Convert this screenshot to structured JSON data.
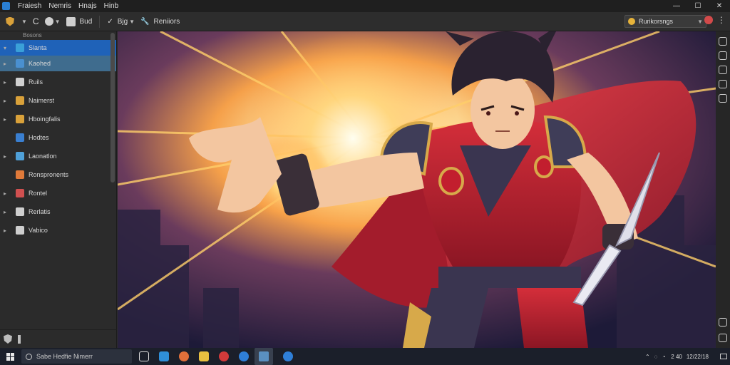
{
  "menu": [
    "Fraiesh",
    "Nemris",
    "Hnajs",
    "Hinb"
  ],
  "toolbar": {
    "edit_label": "Bjg",
    "tool_label": "Reniiors",
    "app_label": "Bud",
    "profile": "Rurikorsngs"
  },
  "sidebar": {
    "header": "Bosons",
    "items": [
      {
        "label": "Slanta",
        "color": "#3aa0d8",
        "state": "selected",
        "arrow": "▾"
      },
      {
        "label": "Kaohed",
        "color": "#4a90d0",
        "state": "sub",
        "arrow": "▸"
      },
      {
        "label": "Ruils",
        "color": "#d0d0d0",
        "state": "",
        "arrow": "▸"
      },
      {
        "label": "Naimerst",
        "color": "#d9a13a",
        "state": "",
        "arrow": "▸"
      },
      {
        "label": "Hboingfalis",
        "color": "#d9a13a",
        "state": "",
        "arrow": "▸"
      },
      {
        "label": "Hodtes",
        "color": "#3a7fd0",
        "state": "",
        "arrow": ""
      },
      {
        "label": "Laonatlon",
        "color": "#4fa0d8",
        "state": "",
        "arrow": "▸"
      },
      {
        "label": "Ronspronents",
        "color": "#e07a3a",
        "state": "",
        "arrow": ""
      },
      {
        "label": "Rontel",
        "color": "#d05050",
        "state": "",
        "arrow": "▸"
      },
      {
        "label": "Rerlatis",
        "color": "#cfcfcf",
        "state": "",
        "arrow": "▸"
      },
      {
        "label": "Vabico",
        "color": "#cfcfcf",
        "state": "",
        "arrow": "▸"
      }
    ]
  },
  "taskbar": {
    "search_placeholder": "Sabe Hedfie Nimerr",
    "clock_time": "2 40",
    "clock_date": "12/22/18"
  }
}
